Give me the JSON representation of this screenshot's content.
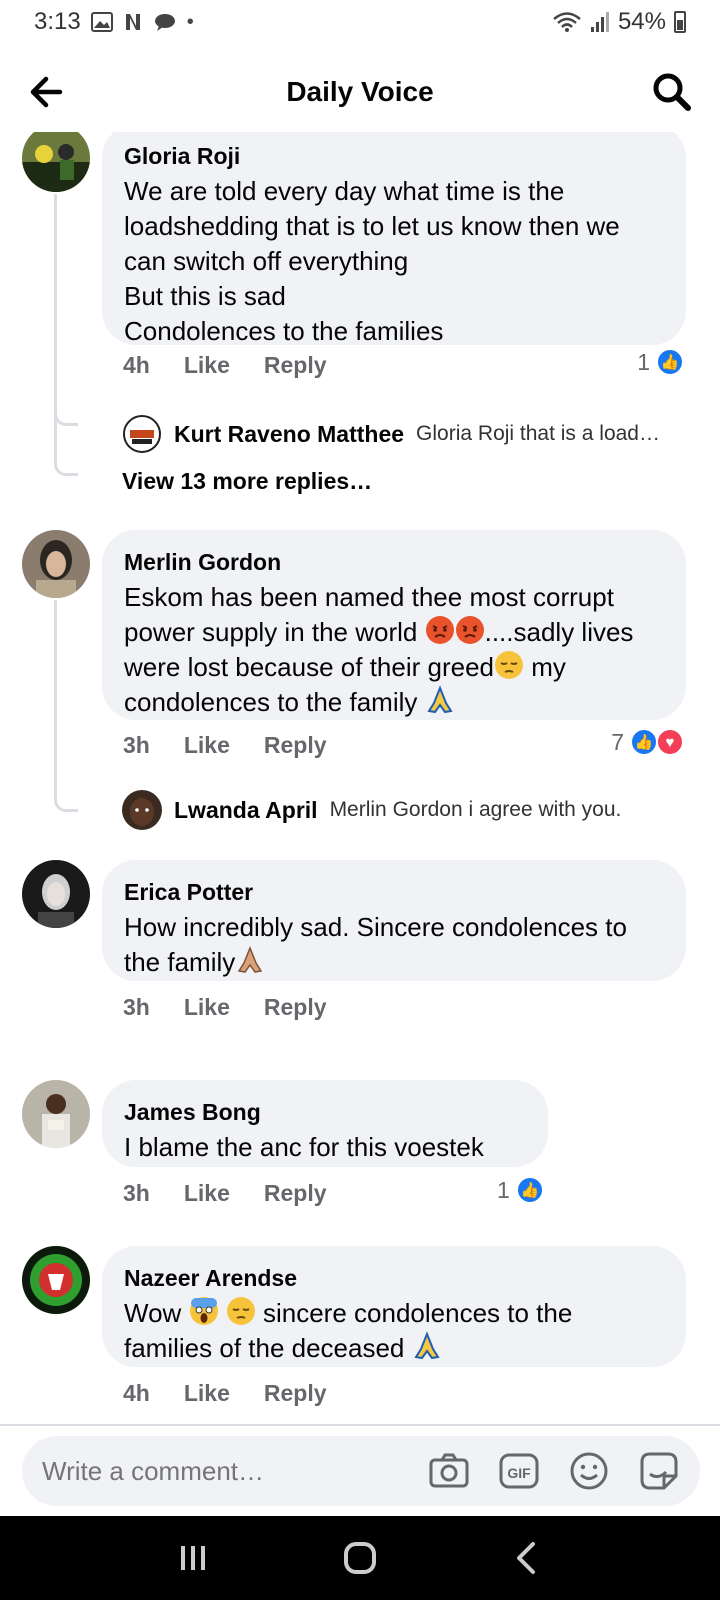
{
  "status_bar": {
    "time": "3:13",
    "battery": "54%"
  },
  "header": {
    "title": "Daily Voice"
  },
  "comments": [
    {
      "author": "Gloria Roji",
      "text": "We are told every day what time is the loadshedding that is to let us know then we can switch off everything\nBut this is sad\nCondolences to the families",
      "time": "4h",
      "like": "Like",
      "reply": "Reply",
      "reaction_count": "1",
      "replies": [
        {
          "author": "Kurt Raveno Matthee",
          "text": "Gloria Roji that is a load…"
        }
      ],
      "more_replies": "View 13 more replies…"
    },
    {
      "author": "Merlin Gordon",
      "text_1": "Eskom has been named thee most corrupt power supply in the world ",
      "text_2": "....sadly lives were lost because of their greed",
      "text_3": " my condolences to the family ",
      "time": "3h",
      "like": "Like",
      "reply": "Reply",
      "reaction_count": "7",
      "replies": [
        {
          "author": "Lwanda April",
          "text": "Merlin Gordon i agree with you."
        }
      ]
    },
    {
      "author": "Erica Potter",
      "text": "How incredibly sad. Sincere condolences to the family",
      "time": "3h",
      "like": "Like",
      "reply": "Reply"
    },
    {
      "author": "James Bong",
      "text": "I blame the anc for this voestek",
      "time": "3h",
      "like": "Like",
      "reply": "Reply",
      "reaction_count": "1"
    },
    {
      "author": "Nazeer Arendse",
      "text_1": "Wow ",
      "text_2": " sincere condolences to the families of the deceased ",
      "time": "4h",
      "like": "Like",
      "reply": "Reply"
    }
  ],
  "composer": {
    "placeholder": "Write a comment…"
  },
  "colors": {
    "like_blue": "#1877f2",
    "love_red": "#f33e58",
    "bubble": "#f0f2f5",
    "meta_gray": "#65676b"
  }
}
